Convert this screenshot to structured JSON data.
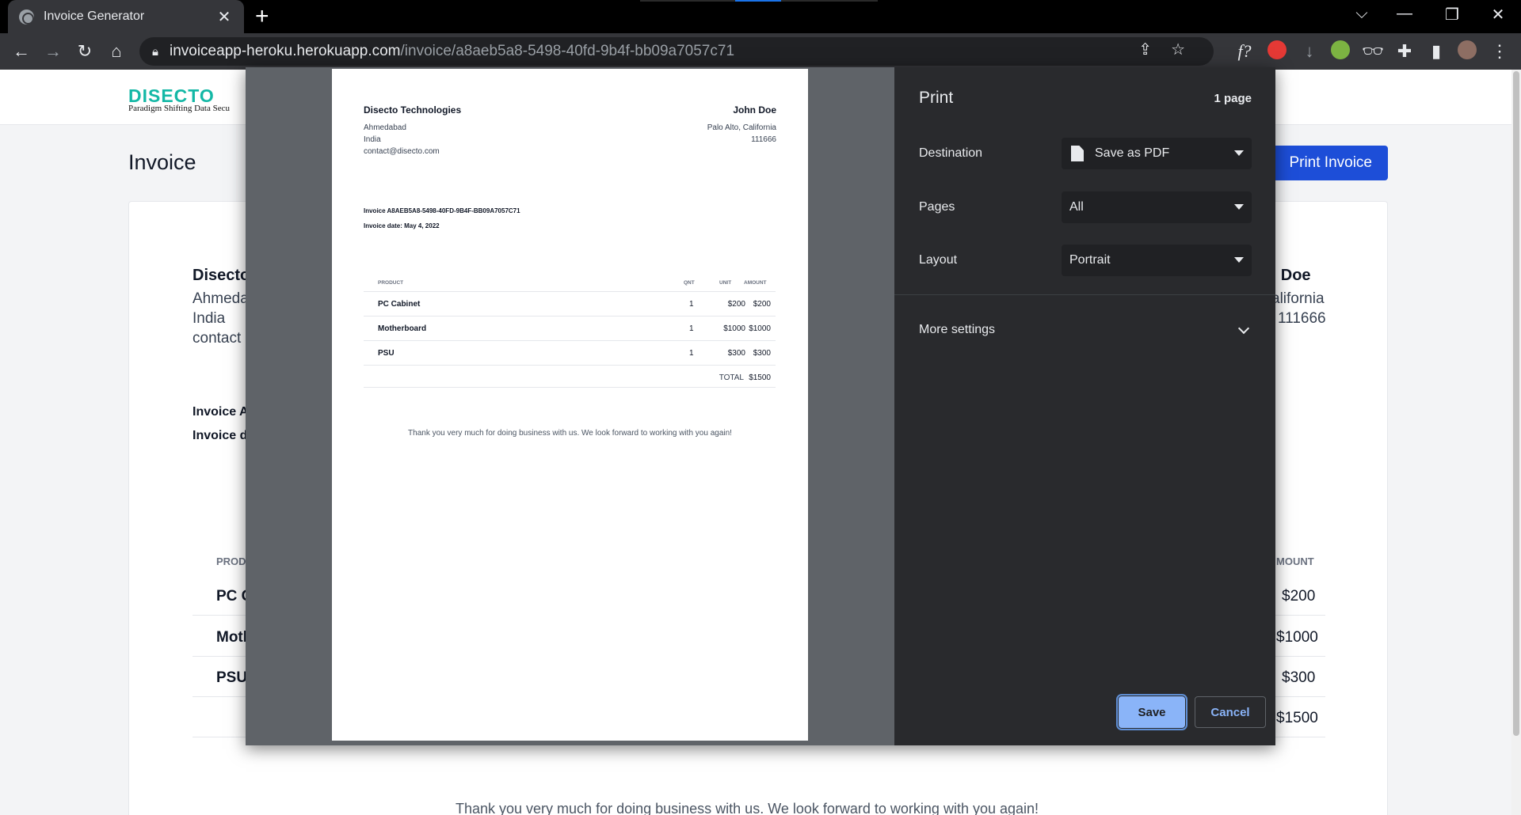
{
  "browser": {
    "tab_title": "Invoice Generator",
    "url_host": "invoiceapp-heroku.herokuapp.com",
    "url_path": "/invoice/a8aeb5a8-5498-40fd-9b4f-bb09a7057c71",
    "newtab": "+",
    "tab_close": "✕"
  },
  "site": {
    "logo": "DISECTO",
    "tagline": "Paradigm Shifting Data Secu",
    "page_title": "Invoice",
    "print_button": "Print Invoice",
    "company_partial": "Disecto",
    "city_partial": "Ahmeda",
    "country": "India",
    "email_partial": "contact",
    "client_partial": "n Doe",
    "client_city_partial": "alifornia",
    "client_zip": "111666",
    "invoice_no_partial": "Invoice A",
    "invoice_date_partial": "Invoice d",
    "col_product_partial": "PROD",
    "col_amount_partial": "MOUNT",
    "rows_partial": [
      {
        "product": "PC C",
        "amount": "$200"
      },
      {
        "product": "Moth",
        "amount": "$1000"
      },
      {
        "product": "PSU",
        "amount": "$300"
      }
    ],
    "total_amount": "$1500",
    "thanks": "Thank you very much for doing business with us. We look forward to working with you again!"
  },
  "preview": {
    "company": "Disecto Technologies",
    "company_city": "Ahmedabad",
    "company_country": "India",
    "company_email": "contact@disecto.com",
    "client": "John Doe",
    "client_city": "Palo Alto, California",
    "client_zip": "111666",
    "invoice_number": "Invoice A8AEB5A8-5498-40FD-9B4F-BB09A7057C71",
    "invoice_date": "Invoice date: May 4, 2022",
    "headers": {
      "product": "PRODUCT",
      "qnt": "QNT",
      "unit": "UNIT",
      "amount": "AMOUNT"
    },
    "rows": [
      {
        "product": "PC Cabinet",
        "qnt": "1",
        "unit": "$200",
        "amount": "$200"
      },
      {
        "product": "Motherboard",
        "qnt": "1",
        "unit": "$1000",
        "amount": "$1000"
      },
      {
        "product": "PSU",
        "qnt": "1",
        "unit": "$300",
        "amount": "$300"
      }
    ],
    "total_label": "TOTAL",
    "total_value": "$1500",
    "thanks": "Thank you very much for doing business with us. We look forward to working with you again!"
  },
  "print_dialog": {
    "title": "Print",
    "page_count": "1 page",
    "destination_label": "Destination",
    "destination_value": "Save as PDF",
    "pages_label": "Pages",
    "pages_value": "All",
    "layout_label": "Layout",
    "layout_value": "Portrait",
    "more_settings": "More settings",
    "save": "Save",
    "cancel": "Cancel"
  },
  "colors": {
    "accent": "#8ab4f8",
    "brand": "#14b8a6",
    "print_button": "#1d4ed8"
  }
}
